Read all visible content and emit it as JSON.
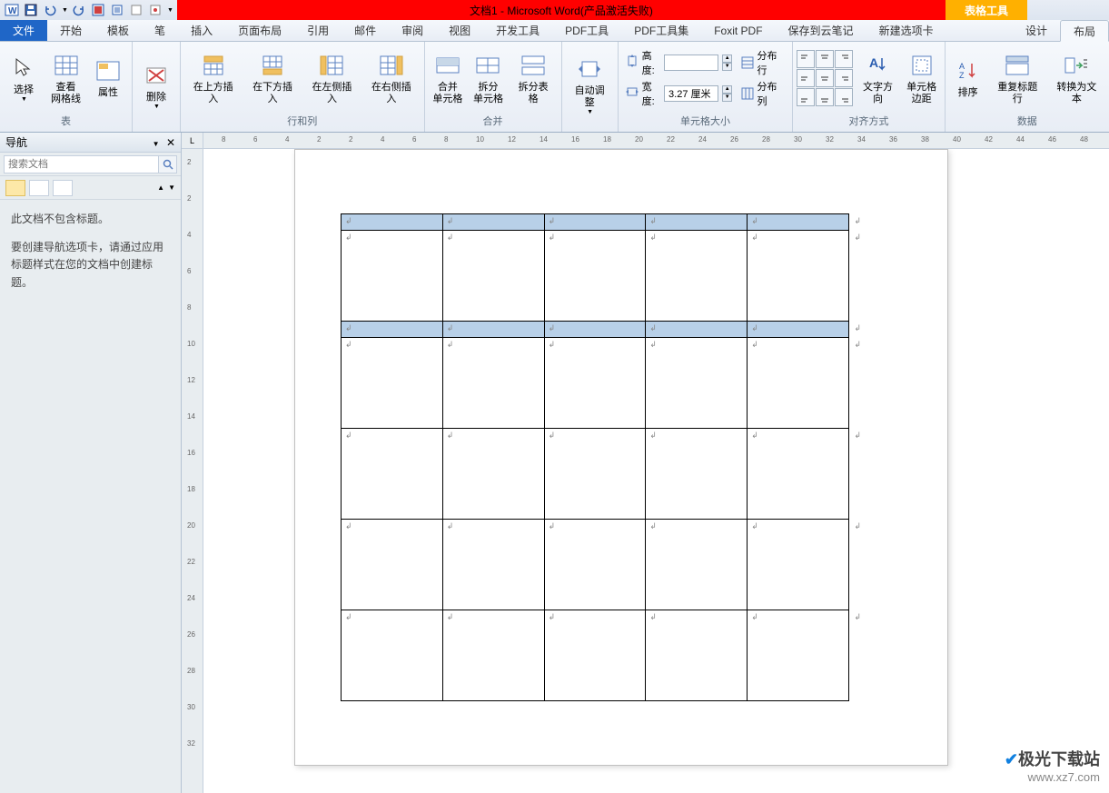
{
  "title": "文档1 - Microsoft Word(产品激活失败)",
  "tableTools": "表格工具",
  "tabs": {
    "file": "文件",
    "items": [
      "开始",
      "模板",
      "笔",
      "插入",
      "页面布局",
      "引用",
      "邮件",
      "审阅",
      "视图",
      "开发工具",
      "PDF工具",
      "PDF工具集",
      "Foxit PDF",
      "保存到云笔记",
      "新建选项卡"
    ],
    "contextual": [
      "设计",
      "布局"
    ]
  },
  "ribbon": {
    "grp_table": {
      "label": "表",
      "select": "选择",
      "gridlines": "查看\n网格线",
      "properties": "属性"
    },
    "grp_delete": {
      "label": "",
      "delete": "删除"
    },
    "grp_rowscols": {
      "label": "行和列",
      "insAbove": "在上方插入",
      "insBelow": "在下方插入",
      "insLeft": "在左侧插入",
      "insRight": "在右侧插入"
    },
    "grp_merge": {
      "label": "合并",
      "merge": "合并\n单元格",
      "split": "拆分\n单元格",
      "splitTable": "拆分表格"
    },
    "grp_autofit": {
      "label": "",
      "autofit": "自动调整"
    },
    "grp_size": {
      "label": "单元格大小",
      "heightLabel": "高度:",
      "heightVal": "",
      "widthLabel": "宽度:",
      "widthVal": "3.27 厘米",
      "distRows": "分布行",
      "distCols": "分布列"
    },
    "grp_align": {
      "label": "对齐方式",
      "textDir": "文字方向",
      "cellMargin": "单元格\n边距"
    },
    "grp_data": {
      "label": "数据",
      "sort": "排序",
      "repeatHeader": "重复标题行",
      "convertText": "转换为文本"
    }
  },
  "nav": {
    "title": "导航",
    "searchPlaceholder": "搜索文档",
    "noHeadings": "此文档不包含标题。",
    "createHint": "要创建导航选项卡，请通过应用标题样式在您的文档中创建标题。"
  },
  "hRulerMarks": [
    "8",
    "6",
    "4",
    "2",
    "2",
    "4",
    "6",
    "8",
    "10",
    "12",
    "14",
    "16",
    "18",
    "20",
    "22",
    "24",
    "26",
    "28",
    "30",
    "32",
    "34",
    "36",
    "38",
    "40",
    "42",
    "44",
    "46",
    "48"
  ],
  "vRulerMarks": [
    "2",
    "2",
    "4",
    "6",
    "8",
    "10",
    "12",
    "14",
    "16",
    "18",
    "20",
    "22",
    "24",
    "26",
    "28",
    "30",
    "32"
  ],
  "watermark": {
    "site": "极光下载站",
    "url": "www.xz7.com"
  }
}
